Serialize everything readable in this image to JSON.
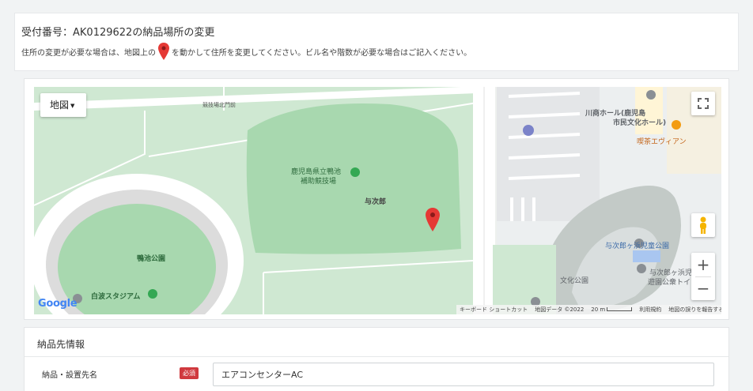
{
  "header": {
    "title": "受付番号：AK0129622の納品場所の変更",
    "instruction_before": "住所の変更が必要な場合は、地図上の",
    "instruction_after": "を動かして住所を変更してください。ビル名や階数が必要な場合はご記入ください。"
  },
  "map": {
    "map_type_label": "地図",
    "zoom_in_label": "+",
    "zoom_out_label": "−",
    "google_logo": "Google",
    "labels": {
      "field_north_gate": "競技場北門前",
      "stadium_name_line1": "鹿児島県立鴨池",
      "stadium_name_line2": "補助競技場",
      "yojiro": "与次郎",
      "kamoike_park": "鴨池公園",
      "shiranami_stadium": "白波スタジアム",
      "kawasho_hall_line1": "川商ホール(鹿児島",
      "kawasho_hall_line2": "市民文化ホール)",
      "cafe": "喫茶エヴィアン",
      "yojigahama_park": "与次郎ヶ浜児童公園",
      "yojigahama_park2_line1": "与次郎ヶ浜児",
      "yojigahama_park2_line2": "遊園公衆トイレ",
      "bunka_park": "文化公園"
    },
    "attribution": {
      "shortcuts": "キーボード ショートカット",
      "map_data": "地図データ ©2022",
      "scale": "20 m",
      "terms": "利用規約",
      "report": "地図の誤りを報告する"
    },
    "colors": {
      "park_green": "#c9e6cd",
      "field_green": "#a8d8af",
      "pin_red": "#e53935"
    }
  },
  "section": {
    "title": "納品先情報",
    "field_label": "納品・設置先名",
    "required_badge": "必須",
    "field_value": "エアコンセンターAC"
  }
}
